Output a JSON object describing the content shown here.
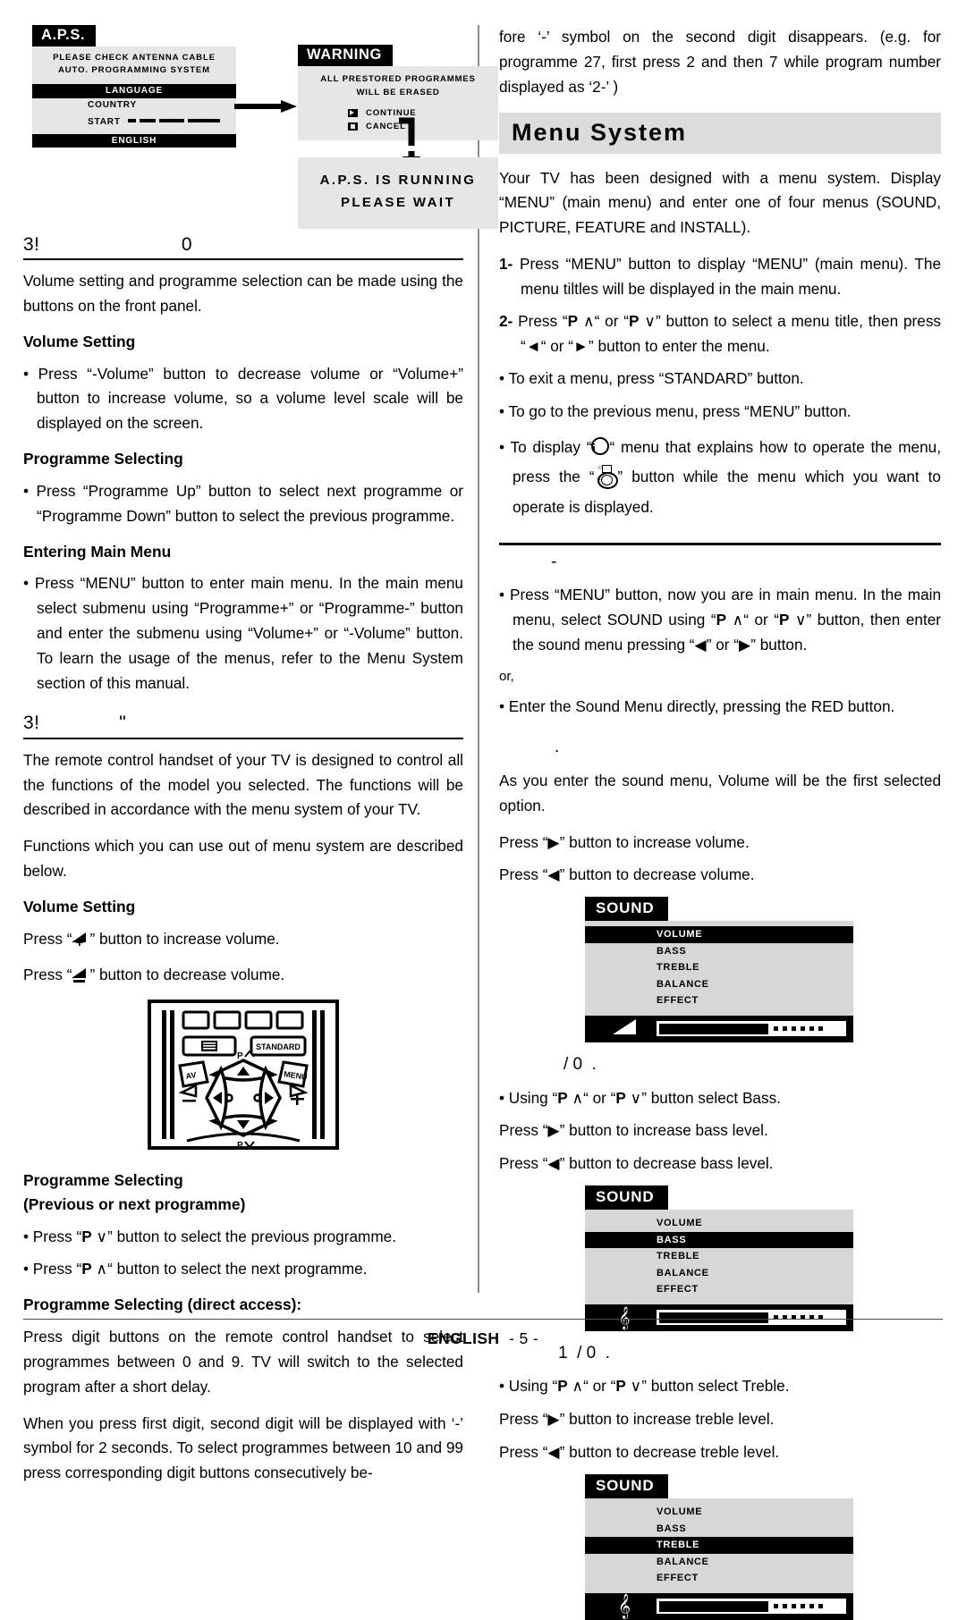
{
  "figure_aps": {
    "title": "A.P.S.",
    "line1": "PLEASE CHECK ANTENNA CABLE",
    "line2": "AUTO. PROGRAMMING SYSTEM",
    "menu": [
      "LANGUAGE",
      "COUNTRY",
      "START"
    ],
    "footer": "ENGLISH",
    "warning_title": "WARNING",
    "warning_line1": "ALL PRESTORED PROGRAMMES",
    "warning_line2": "WILL BE ERASED",
    "opt_continue": "CONTINUE",
    "opt_cancel": "CANCEL",
    "running_line1": "A.P.S. IS RUNNING",
    "running_line2": "PLEASE  WAIT"
  },
  "left": {
    "heading1": "3!                         0",
    "intro": "Volume setting and programme selection can be made using the buttons on the front panel.",
    "h_volume_setting": "Volume Setting",
    "b_volume": "Press “-Volume” button to decrease volume or “Volume+” button to increase volume, so a volume level scale will be displayed on the screen.",
    "h_programme_selecting": "Programme Selecting",
    "b_programme": "Press “Programme Up” button to select next programme or “Programme Down” button to select the previous programme.",
    "h_entering_main_menu": "Entering Main Menu",
    "b_entering": "Press “MENU” button to enter main menu. In the main menu select submenu using “Programme+” or “Programme-” button and enter the submenu using “Volume+” or “-Volume” button. To learn the usage of the menus, refer to the Menu System section of this manual.",
    "heading2": "3!              \"",
    "p_remote": "The remote control handset of your TV is designed to control all the functions of the model you selected. The functions will be described  in accordance with the menu system of your TV.",
    "p_functions": "Functions which you can use out of menu system are described below.",
    "h_volume_setting2": "Volume Setting",
    "p_vol_inc": "button to increase volume.",
    "p_vol_dec": "button  to decrease volume.",
    "h_prog_sel2_l1": "Programme Selecting",
    "h_prog_sel2_l2": "(Previous or next programme)",
    "b_prev": "button to select the previous programme.",
    "b_next": "button to select the next programme.",
    "h_direct": "Programme Selecting (direct access):",
    "p_direct1": "Press digit buttons on the remote control handset to select programmes between 0 and 9. TV will switch to the selected program after a short delay.",
    "p_direct2": "When you press first digit, second digit will be displayed with ‘-’ symbol for 2 seconds. To select programmes between 10 and 99 press corresponding digit buttons consecutively be-"
  },
  "remote": {
    "btn_teletext": "teletext-icon",
    "btn_standard": "STANDARD",
    "btn_av": "AV",
    "btn_menu": "MENU",
    "label_p_up": "P",
    "label_p_down": "P"
  },
  "right": {
    "p_continued": "fore ‘-’ symbol on the second digit disappears. (e.g. for programme 27, first press 2 and then 7 while program number displayed as ‘2-’ )",
    "banner_menu_system": "Menu System",
    "p_intro": "Your TV has been designed with a menu system. Display “MENU” (main menu) and enter one of four menus (SOUND, PICTURE, FEATURE and INSTALL).",
    "step1": "Press “MENU” button to display “MENU” (main menu). The menu tiltles will be displayed in the main menu.",
    "step1_no": "1-",
    "step2_no": "2-",
    "step2": "button to select a menu title, then press",
    "step2_tail": "button to enter the menu.",
    "b_exit": "To exit a menu, press “STANDARD” button.",
    "b_prev_menu": "To go to the previous menu, press “MENU” button.",
    "b_info_1": "To display “",
    "b_info_2": "“ menu that explains how to operate the",
    "b_info_3": "menu, press the “",
    "b_info_4": "” button while the menu which you want to operate is displayed.",
    "sec_sound_head": "-",
    "b_sound_enter": "Press “MENU” button,  now you are in main menu. In the main menu, select SOUND using",
    "b_sound_enter_tail": "button, then enter the sound menu pressing “◀” or “▶” button.",
    "or": "or,",
    "b_sound_red": "Enter the Sound Menu directly, pressing the RED button.",
    "sec_volume_head": ".",
    "p_volume_first": "As you enter the sound menu, Volume will be the first selected option.",
    "b_vol_inc": "Press “▶” button to increase volume.",
    "b_vol_dec": "Press “◀” button to decrease volume.",
    "sec_bass_head": "/ 0  .",
    "b_bass_sel": "button select Bass.",
    "b_bass_inc": "Press “▶” button to increase bass level.",
    "b_bass_dec": "Press “◀” button to decrease bass level.",
    "sec_treble_head": "1  / 0  .",
    "b_treble_sel": "button select Treble.",
    "b_treble_inc": "Press “▶” button to increase treble level.",
    "b_treble_dec": "Press “◀” button to decrease treble level.",
    "using_prefix": "Using “"
  },
  "sound_menus": [
    {
      "title": "SOUND",
      "items": [
        "VOLUME",
        "BASS",
        "TREBLE",
        "BALANCE",
        "EFFECT"
      ],
      "selected": "VOLUME",
      "icon": "speaker-icon",
      "fill_percent": 67
    },
    {
      "title": "SOUND",
      "items": [
        "VOLUME",
        "BASS",
        "TREBLE",
        "BALANCE",
        "EFFECT"
      ],
      "selected": "BASS",
      "icon": "bass-clef-icon",
      "fill_percent": 67
    },
    {
      "title": "SOUND",
      "items": [
        "VOLUME",
        "BASS",
        "TREBLE",
        "BALANCE",
        "EFFECT"
      ],
      "selected": "TREBLE",
      "icon": "treble-clef-icon",
      "fill_percent": 67
    }
  ],
  "footer": {
    "language": "ENGLISH",
    "page": "- 5 -"
  }
}
